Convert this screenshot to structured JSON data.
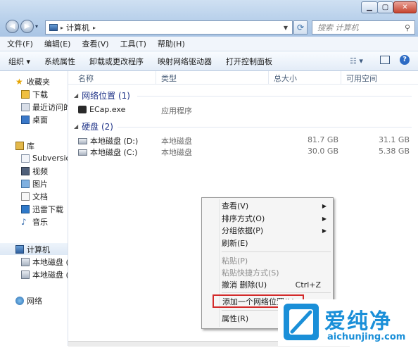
{
  "address": {
    "segment": "计算机"
  },
  "search": {
    "placeholder": "搜索 计算机"
  },
  "menubar": [
    "文件(F)",
    "编辑(E)",
    "查看(V)",
    "工具(T)",
    "帮助(H)"
  ],
  "toolbar": [
    "组织 ▾",
    "系统属性",
    "卸载或更改程序",
    "映射网络驱动器",
    "打开控制面板"
  ],
  "nav": {
    "favorites": "收藏夹",
    "downloads": "下载",
    "recent": "最近访问的",
    "desktop": "桌面",
    "libraries": "库",
    "subversion": "Subversion",
    "videos": "视频",
    "pictures": "图片",
    "documents": "文档",
    "thunder": "迅雷下载",
    "music": "音乐",
    "computer": "计算机",
    "disk_c": "本地磁盘 (C",
    "disk_d": "本地磁盘 (D",
    "network": "网络"
  },
  "columns": [
    "名称",
    "类型",
    "总大小",
    "可用空间"
  ],
  "groups": {
    "network": "网络位置 (1)",
    "drives": "硬盘 (2)"
  },
  "items": [
    {
      "name": "ECap.exe",
      "type": "应用程序",
      "total": "",
      "free": ""
    },
    {
      "name": "本地磁盘 (D:)",
      "type": "本地磁盘",
      "total": "81.7 GB",
      "free": "31.1 GB"
    },
    {
      "name": "本地磁盘 (C:)",
      "type": "本地磁盘",
      "total": "30.0 GB",
      "free": "5.38 GB"
    }
  ],
  "context_menu": {
    "view": "查看(V)",
    "sort": "排序方式(O)",
    "group": "分组依据(P)",
    "refresh": "刷新(E)",
    "paste": "粘贴(P)",
    "paste_shortcut": "粘贴快捷方式(S)",
    "undo_delete": "撤消 删除(U)",
    "undo_shortcut": "Ctrl+Z",
    "add_network": "添加一个网络位置(L)",
    "properties": "属性(R)"
  },
  "watermark": {
    "cn": "爱纯净",
    "url": "aichunjing.com"
  },
  "colors": {
    "accent": "#1e3287",
    "highlight": "#d32a2a",
    "logo": "#1a8fd8"
  }
}
